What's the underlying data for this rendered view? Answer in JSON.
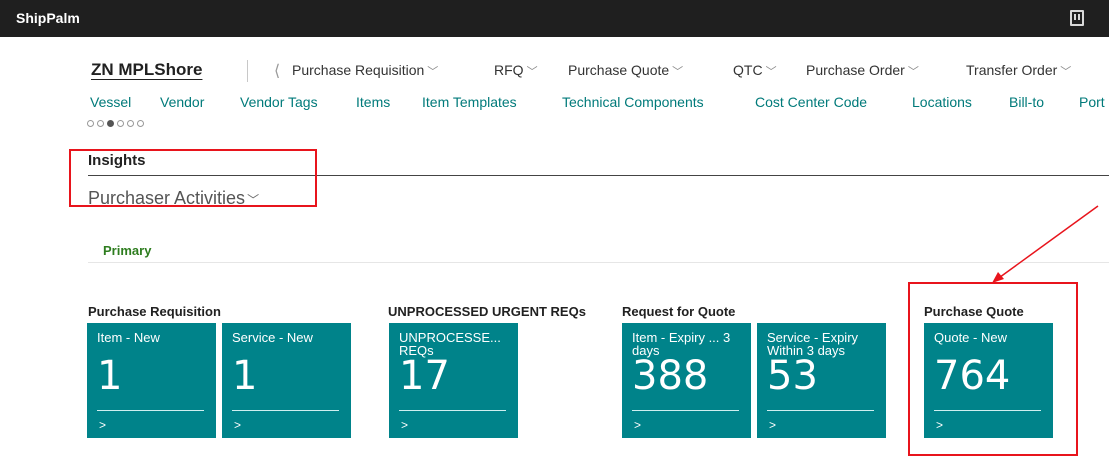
{
  "app": {
    "title": "ShipPalm",
    "top_icon": "building-icon"
  },
  "header": {
    "company": "ZN MPLShore",
    "back_glyph": "⟨",
    "menus": [
      {
        "label": "Purchase Requisition"
      },
      {
        "label": "RFQ"
      },
      {
        "label": "Purchase Quote"
      },
      {
        "label": "QTC"
      },
      {
        "label": "Purchase Order"
      },
      {
        "label": "Transfer Order"
      }
    ],
    "chevron": "﹀"
  },
  "links": [
    "Vessel",
    "Vendor",
    "Vendor Tags",
    "Items",
    "Item Templates",
    "Technical Components",
    "Cost Center Code",
    "Locations",
    "Bill-to",
    "Port"
  ],
  "pager": {
    "count": 6,
    "active_index": 2
  },
  "insights": {
    "title": "Insights",
    "subtitle": "Purchaser Activities",
    "chevron": "﹀"
  },
  "section": {
    "label": "Primary"
  },
  "groups": [
    {
      "title": "Purchase Requisition",
      "tiles": [
        {
          "label": "Item - New",
          "value": "1",
          "arrow": ">"
        },
        {
          "label": "Service - New",
          "value": "1",
          "arrow": ">"
        }
      ]
    },
    {
      "title": "UNPROCESSED URGENT REQs",
      "tiles": [
        {
          "label": "UNPROCESSE... REQs",
          "value": "17",
          "arrow": ">"
        }
      ]
    },
    {
      "title": "Request for Quote",
      "tiles": [
        {
          "label": "Item - Expiry ... 3 days",
          "value": "388",
          "arrow": ">"
        },
        {
          "label": "Service - Expiry Within 3 days",
          "value": "53",
          "arrow": ">"
        }
      ]
    },
    {
      "title": "Purchase Quote",
      "tiles": [
        {
          "label": "Quote - New",
          "value": "764",
          "arrow": ">"
        }
      ]
    }
  ],
  "colors": {
    "tile": "#00838a",
    "link": "#007a7a",
    "primary": "#2e7d1f",
    "highlight": "#e8141c",
    "topbar": "#1f1f1f"
  }
}
